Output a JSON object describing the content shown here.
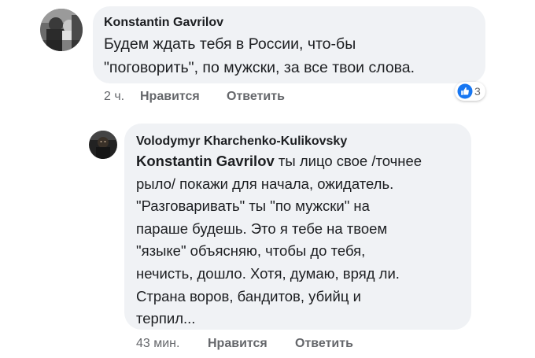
{
  "comments": [
    {
      "author": "Konstantin Gavrilov",
      "text": "Будем ждать тебя в России, что-бы\n\"поговорить\", по мужски, за все твои слова.",
      "time": "2 ч.",
      "like_label": "Нравится",
      "reply_label": "Ответить",
      "reaction": {
        "icon": "thumbs-up-icon",
        "count": "3",
        "color": "#1877f2"
      }
    },
    {
      "author": "Volodymyr Kharchenko-Kulikovsky",
      "mention": "Konstantin Gavrilov",
      "text": " ты лицо свое /точнее\nрыло/ покажи для начала, ожидатель.\n\"Разговаривать\" ты \"по мужски\" на\nпараше будешь. Это я тебе на твоем\n\"языке\" объясняю, чтобы до тебя,\nнечисть, дошло. Хотя, думаю, вряд ли.\nСтрана воров, бандитов, убийц и\nтерпил...",
      "time": "43 мин.",
      "like_label": "Нравится",
      "reply_label": "Ответить"
    }
  ]
}
